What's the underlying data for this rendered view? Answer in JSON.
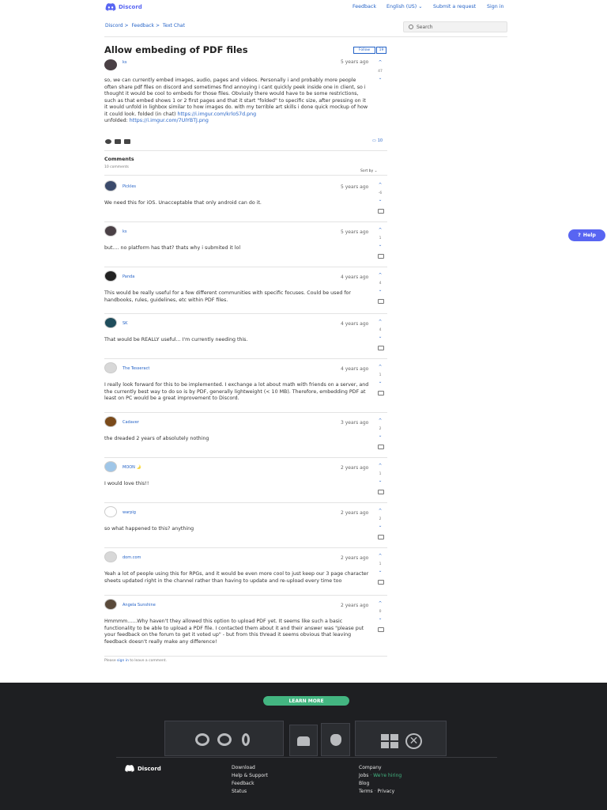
{
  "nav": {
    "brand": "Discord",
    "feedback": "Feedback",
    "language": "English (US)",
    "submit": "Submit a request",
    "signin": "Sign in"
  },
  "breadcrumb": [
    "Discord",
    "Feedback",
    "Text Chat"
  ],
  "search_placeholder": "Search",
  "post": {
    "title": "Allow embeding of PDF files",
    "follow": "Follow",
    "follow_count": "19",
    "author": "ks",
    "time": "5 years ago",
    "votes": "47",
    "body": "so, we can currently embed images, audio, pages and videos. Personally i and probably more people often share pdf files on discord and sometimes find annoying i cant quickly peek inside one in client, so i thought it would be cool to embeds for those files. Obviusly there would have to be some restrictions, such as that embed shows 1 or 2 first pages and that it start \"folded\" to specific size, after pressing on it it would unfold in lighbox similar to how images do. with my terrible art skills i done quick mockup of how it could look. folded (in chat) ",
    "link1": "https://i.imgur.com/krloS7d.png",
    "unfolded_label": "unfolded: ",
    "link2": "https://i.imgur.com/7UIYBTJ.png",
    "comment_count_icon": "10"
  },
  "comments_header": "Comments",
  "comments_sub": "10 comments",
  "sortby": "Sort by",
  "comments": [
    {
      "author": "Pickles",
      "time": "5 years ago",
      "votes": "-6",
      "text": "We need this for iOS. Unacceptable that only android can do it.",
      "avatar": "#3b4a6b"
    },
    {
      "author": "ks",
      "time": "5 years ago",
      "votes": "1",
      "text": "but.... no platform has that? thats why i submited it lol",
      "avatar": "#4a4045"
    },
    {
      "author": "Panda",
      "time": "4 years ago",
      "votes": "4",
      "text": "This would be really useful for a few different communities with specific focuses. Could be used for handbooks, rules, guidelines, etc within PDF files.",
      "avatar": "#222222"
    },
    {
      "author": "SK",
      "time": "4 years ago",
      "votes": "4",
      "text": "That would be REALLY useful... I'm currently needing this.",
      "avatar": "#1f4d5c"
    },
    {
      "author": "The Tesseract",
      "time": "4 years ago",
      "votes": "1",
      "text": "I really look forward for this to be implemented. I exchange a lot about math with friends on a server, and the currently best way to do so is by PDF, generally lightweight (< 10 MB). Therefore, embedding PDF at least on PC would be a great improvement to Discord.",
      "avatar": "#d8d8d8"
    },
    {
      "author": "Cadaver",
      "time": "3 years ago",
      "votes": "2",
      "text": "the dreaded 2 years of absolutely nothing",
      "avatar": "#7a4a1a"
    },
    {
      "author": "MOON 🌛",
      "time": "2 years ago",
      "votes": "1",
      "text": "I would love this!!",
      "avatar": "#9fc6e8"
    },
    {
      "author": "warpig",
      "time": "2 years ago",
      "votes": "2",
      "text": "so what happened to this? anything",
      "avatar": "#ffffff"
    },
    {
      "author": "dom.com",
      "time": "2 years ago",
      "votes": "1",
      "text": "Yeah a lot of people using this for RPGs, and it would be even more cool to just keep our 3 page character sheets updated right in the channel rather than having to update and re-upload every time too",
      "avatar": "#d8d8d8"
    },
    {
      "author": "Angela Sunshine",
      "time": "2 years ago",
      "votes": "0",
      "text": "Hmmmm......Why haven't they allowed this option to upload PDF yet. It seems like such a basic functionality to be able to upload a PDF file. I contacted them about it and their answer was \"please put your feedback on the forum to get it voted up\" - but from this thread it seems obvious that leaving feedback doesn't really make any difference!",
      "avatar": "#5a4a3a"
    }
  ],
  "signin_note": {
    "pre": "Please ",
    "link": "sign in",
    "post": " to leave a comment."
  },
  "help_label": "Help",
  "footer": {
    "learn_more": "LEARN MORE",
    "brand": "Discord",
    "col1": [
      "Download",
      "Help & Support",
      "Feedback",
      "Status"
    ],
    "col2": [
      "Company",
      "Jobs",
      "Blog",
      "Terms"
    ],
    "hiring": "We're hiring",
    "privacy": "Privacy"
  },
  "colors": {
    "accent": "#2563c7",
    "brand": "#5865f2",
    "footer": "#1e1f22",
    "green": "#43b581"
  }
}
